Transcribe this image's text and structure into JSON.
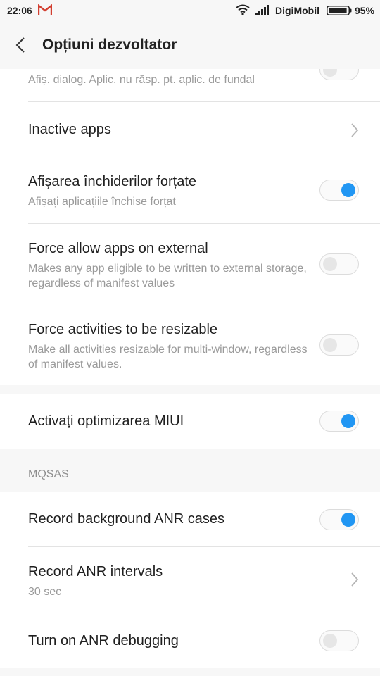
{
  "status_bar": {
    "time": "22:06",
    "carrier": "DigiMobil",
    "battery": "95%",
    "battery_level": 0.95
  },
  "header": {
    "title": "Opțiuni dezvoltator"
  },
  "items": [
    {
      "id": "anr-dialog",
      "subtitle": "Afiș. dialog. Aplic. nu răsp. pt. aplic. de fundal",
      "toggle": false
    },
    {
      "id": "inactive-apps",
      "title": "Inactive apps",
      "chevron": true
    },
    {
      "id": "force-close",
      "title": "Afișarea închiderilor forțate",
      "subtitle": "Afișați aplicațiile închise forțat",
      "toggle": true
    },
    {
      "id": "force-external",
      "title": "Force allow apps on external",
      "subtitle": "Makes any app eligible to be written to external storage, regardless of manifest values",
      "toggle": false
    },
    {
      "id": "force-resizable",
      "title": "Force activities to be resizable",
      "subtitle": "Make all activities resizable for multi-window, regardless of manifest values.",
      "toggle": false
    },
    {
      "id": "miui-opt",
      "title": "Activați optimizarea MIUI",
      "toggle": true
    },
    {
      "id": "record-bg-anr",
      "title": "Record background ANR cases",
      "toggle": true
    },
    {
      "id": "anr-intervals",
      "title": "Record ANR intervals",
      "subtitle": "30 sec",
      "chevron": true
    },
    {
      "id": "anr-debug",
      "title": "Turn on ANR debugging",
      "toggle": false
    }
  ],
  "sections": {
    "mqsas": "MQSAS"
  },
  "colors": {
    "accent": "#2196f3",
    "background": "#f7f7f7",
    "card": "#ffffff",
    "subtitle": "#9a9a9a"
  }
}
